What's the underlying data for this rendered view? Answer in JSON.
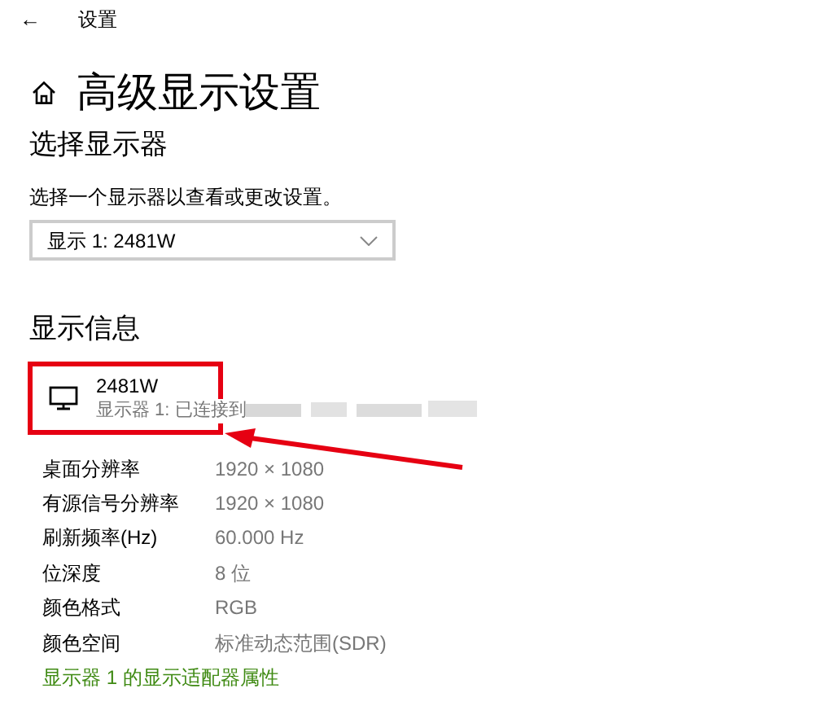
{
  "nav": {
    "back": "←",
    "title": "设置"
  },
  "page_title": "高级显示设置",
  "select_section": {
    "heading": "选择显示器",
    "description": "选择一个显示器以查看或更改设置。",
    "dropdown_value": "显示 1: 2481W"
  },
  "info_section": {
    "heading": "显示信息",
    "monitor": {
      "name": "2481W",
      "status": "显示器 1: 已连接到",
      "highlighted": true
    },
    "rows": [
      {
        "label": "桌面分辨率",
        "value": "1920 × 1080"
      },
      {
        "label": "有源信号分辨率",
        "value": "1920 × 1080"
      },
      {
        "label": "刷新频率(Hz)",
        "value": "60.000 Hz"
      },
      {
        "label": "位深度",
        "value": "8 位"
      },
      {
        "label": "颜色格式",
        "value": "RGB"
      },
      {
        "label": "颜色空间",
        "value": "标准动态范围(SDR)"
      }
    ],
    "link": "显示器 1 的显示适配器属性"
  }
}
